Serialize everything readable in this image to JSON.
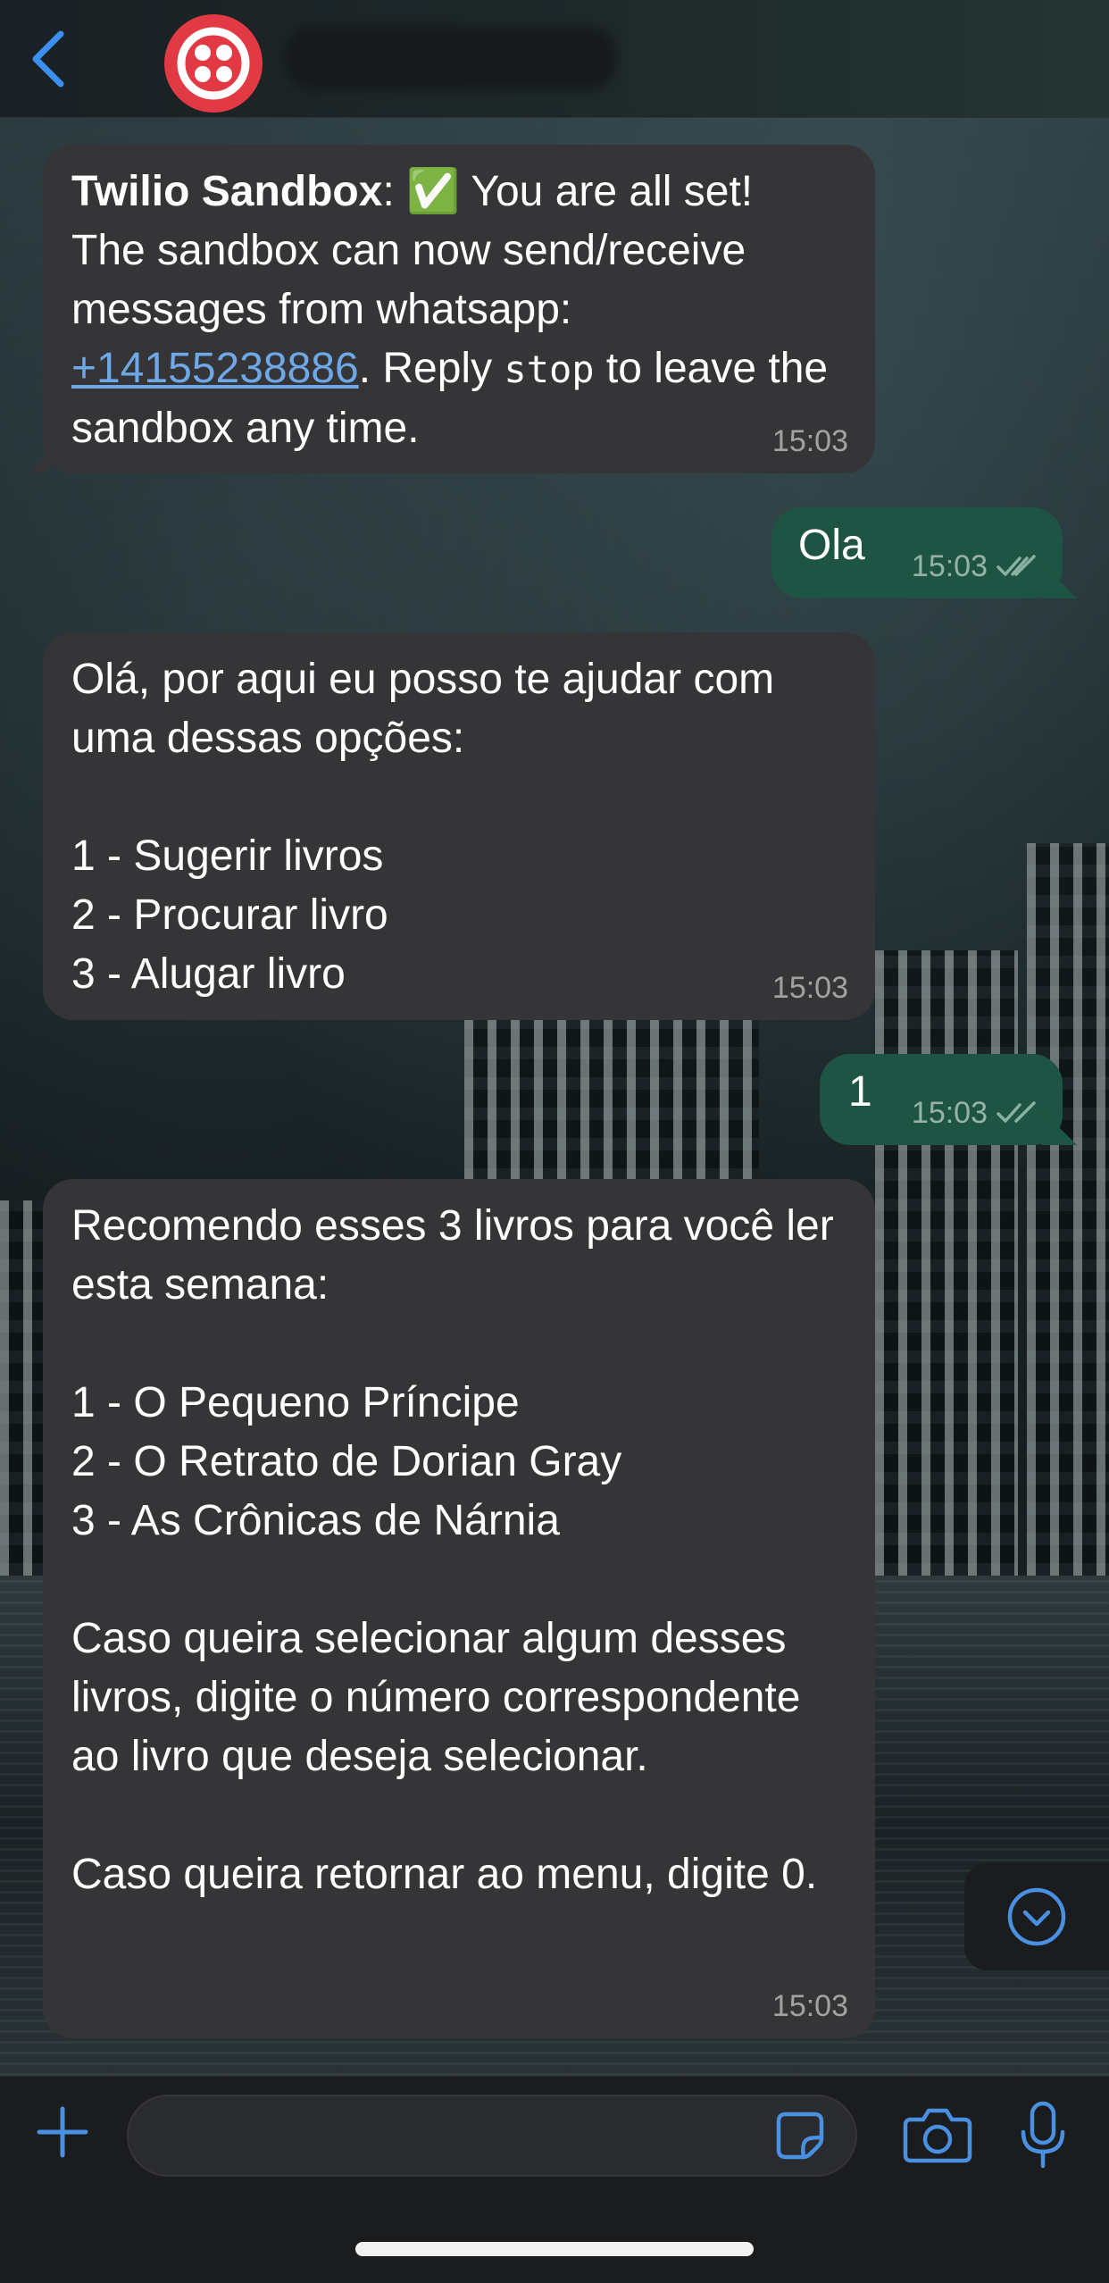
{
  "header": {
    "back_label": "",
    "contact_name": ""
  },
  "messages": [
    {
      "direction": "in",
      "sender": "Twilio Sandbox",
      "emoji": "✅",
      "text_1": "You are all set!",
      "text_2": "The sandbox can now send/receive messages from whatsapp:",
      "phone": "+14155238886",
      "text_3": ". Reply ",
      "command": "stop",
      "text_4": " to leave the sandbox any time.",
      "time": "15:03"
    },
    {
      "direction": "out",
      "text": "Ola",
      "time": "15:03",
      "status": "read"
    },
    {
      "direction": "in",
      "text": "Olá, por aqui eu posso te ajudar com uma dessas opções:\n\n1 - Sugerir livros\n2 - Procurar livro\n3 - Alugar livro",
      "time": "15:03"
    },
    {
      "direction": "out",
      "text": "1",
      "time": "15:03",
      "status": "read"
    },
    {
      "direction": "in",
      "text": "Recomendo esses 3 livros para você ler esta semana:\n\n1 - O Pequeno Príncipe\n2 - O Retrato de Dorian Gray\n3 - As Crônicas de Nárnia\n\nCaso queira selecionar algum desses livros, digite o número correspondente ao livro que deseja selecionar.\n\nCaso queira retornar ao menu, digite 0.",
      "time": "15:03"
    }
  ],
  "composer": {
    "value": "",
    "placeholder": ""
  },
  "icons": {
    "back": "chevron-left-icon",
    "avatar": "twilio-logo",
    "scroll_down": "chevron-down-circle-icon",
    "attach": "plus-icon",
    "sticker": "sticker-icon",
    "camera": "camera-icon",
    "mic": "microphone-icon"
  },
  "colors": {
    "accent": "#4a90e2",
    "incoming_bubble": "#353538",
    "outgoing_bubble": "#1e5443",
    "link": "#6ea8e6",
    "avatar_red": "#e23a44",
    "read_ticks": "#8ab0a4"
  }
}
